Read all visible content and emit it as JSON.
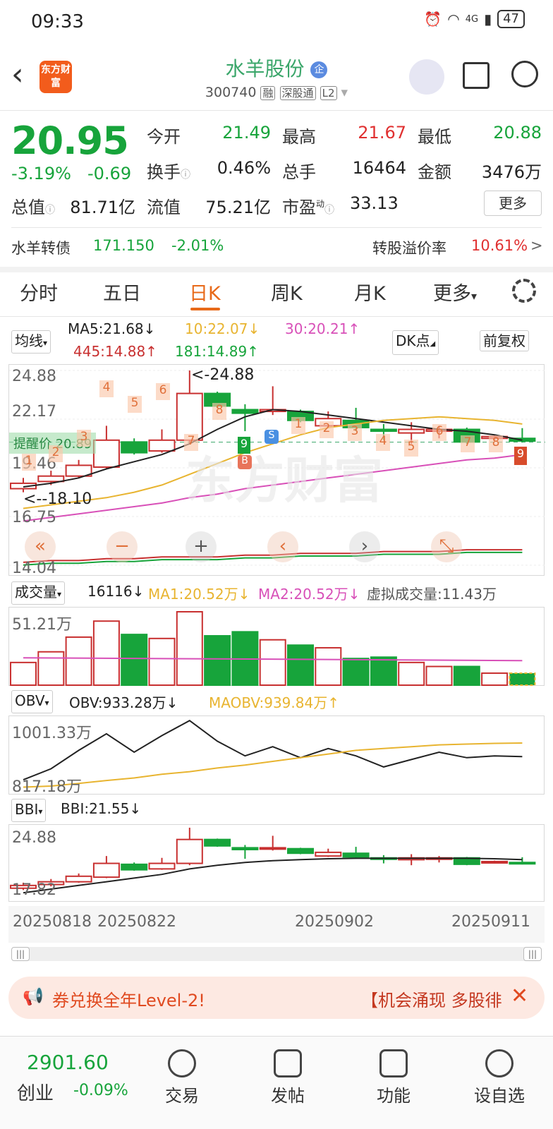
{
  "status": {
    "time": "09:33",
    "network": "4G",
    "battery": "47"
  },
  "header": {
    "back_icon": "chevron-left-icon",
    "app_logo_text": "东方财富",
    "stock_name": "水羊股份",
    "enterprise_badge": "企",
    "code": "300740",
    "tags": [
      "融",
      "深股通",
      "L2"
    ]
  },
  "quote": {
    "price": "20.95",
    "change_pct": "-3.19%",
    "change": "-0.69",
    "open_label": "今开",
    "open": "21.49",
    "high_label": "最高",
    "high": "21.67",
    "low_label": "最低",
    "low": "20.88",
    "turnover_label": "换手",
    "turnover": "0.46%",
    "volume_label": "总手",
    "volume": "16464",
    "amount_label": "金额",
    "amount": "3476万",
    "mcap_label": "总值",
    "mcap": "81.71亿",
    "float_label": "流值",
    "float": "75.21亿",
    "pe_label": "市盈",
    "pe_sup": "动",
    "pe": "33.13",
    "more_button": "更多"
  },
  "conv_bond": {
    "name": "水羊转债",
    "price": "171.150",
    "change": "-2.01%",
    "premium_label": "转股溢价率",
    "premium": "10.61%",
    "arrow": ">"
  },
  "tabs": [
    "分时",
    "五日",
    "日K",
    "周K",
    "月K",
    "更多"
  ],
  "active_tab": "日K",
  "kline": {
    "indicator": "均线",
    "ma5": "MA5:21.68↓",
    "ma10": "10:22.07↓",
    "ma30": "30:20.21↑",
    "ma445": "445:14.88↑",
    "ma181": "181:14.89↑",
    "dk_button": "DK点",
    "adjust_button": "前复权",
    "y_labels": [
      "24.88",
      "22.17",
      "19.46",
      "16.75",
      "14.04"
    ],
    "max_marker": "<-24.88",
    "min_marker": "<--18.10",
    "alert_label": "提醒价",
    "alert_value": "20.89",
    "watermark": "东方财富",
    "marker_b": "B",
    "marker_s": "S",
    "nine_top": "9",
    "nine_last": "9",
    "td_upper": [
      "4",
      "5",
      "6",
      "7",
      "8"
    ],
    "td_lower": [
      "1",
      "2",
      "3",
      "4",
      "5",
      "6",
      "7",
      "8"
    ],
    "td_early": [
      "1",
      "2",
      "3"
    ]
  },
  "volume": {
    "indicator": "成交量",
    "value": "16116↓",
    "ma1": "MA1:20.52万↓",
    "ma2": "MA2:20.52万↓",
    "virtual": "虚拟成交量:11.43万",
    "y_label": "51.21万"
  },
  "obv": {
    "indicator": "OBV",
    "value": "OBV:933.28万↓",
    "maobv": "MAOBV:939.84万↑",
    "y_top": "1001.33万",
    "y_bottom": "817.18万"
  },
  "bbi": {
    "indicator": "BBI",
    "value": "BBI:21.55↓",
    "y_top": "24.88",
    "y_bottom": "17.82"
  },
  "dates": [
    "20250818",
    "20250822",
    "20250902",
    "20250911"
  ],
  "banner": {
    "left": "券兑换全年Level-2!",
    "right": "【机会涌现 多股徘"
  },
  "bottom": {
    "index_value": "2901.60",
    "index_name": "创业",
    "index_change": "-0.09%",
    "items": [
      "交易",
      "发帖",
      "功能",
      "设自选"
    ]
  },
  "colors": {
    "up": "#e03030",
    "down": "#17a43b",
    "accent": "#e86a1a"
  },
  "chart_data": {
    "type": "candlestick",
    "candles": [
      {
        "o": 18.3,
        "c": 18.6,
        "h": 18.9,
        "l": 18.1
      },
      {
        "o": 18.7,
        "c": 19.0,
        "h": 19.3,
        "l": 18.5
      },
      {
        "o": 19.0,
        "c": 19.6,
        "h": 19.9,
        "l": 18.9
      },
      {
        "o": 19.5,
        "c": 21.0,
        "h": 21.8,
        "l": 19.4
      },
      {
        "o": 20.9,
        "c": 20.3,
        "h": 21.1,
        "l": 20.2
      },
      {
        "o": 20.4,
        "c": 21.0,
        "h": 21.6,
        "l": 20.3
      },
      {
        "o": 21.0,
        "c": 23.6,
        "h": 24.88,
        "l": 20.8
      },
      {
        "o": 23.6,
        "c": 22.9,
        "h": 23.7,
        "l": 22.8
      },
      {
        "o": 22.7,
        "c": 22.5,
        "h": 23.0,
        "l": 21.5
      },
      {
        "o": 22.6,
        "c": 22.7,
        "h": 24.0,
        "l": 22.4
      },
      {
        "o": 22.6,
        "c": 22.1,
        "h": 22.7,
        "l": 22.0
      },
      {
        "o": 21.8,
        "c": 22.2,
        "h": 22.6,
        "l": 21.7
      },
      {
        "o": 22.1,
        "c": 21.7,
        "h": 22.8,
        "l": 21.5
      },
      {
        "o": 21.6,
        "c": 21.5,
        "h": 21.9,
        "l": 21.0
      },
      {
        "o": 21.4,
        "c": 21.6,
        "h": 22.0,
        "l": 20.8
      },
      {
        "o": 21.5,
        "c": 21.6,
        "h": 21.8,
        "l": 21.1
      },
      {
        "o": 21.6,
        "c": 20.9,
        "h": 21.7,
        "l": 20.8
      },
      {
        "o": 21.1,
        "c": 21.2,
        "h": 21.3,
        "l": 21.0
      },
      {
        "o": 21.1,
        "c": 20.95,
        "h": 21.67,
        "l": 20.88
      }
    ],
    "volumes": [
      17,
      25,
      36,
      48,
      38,
      35,
      55,
      37,
      40,
      34,
      30,
      28,
      20,
      21,
      17,
      14,
      14,
      9,
      9
    ],
    "vol_ma": 20.52,
    "obv": [
      840,
      870,
      920,
      965,
      915,
      960,
      1001,
      945,
      905,
      930,
      900,
      925,
      905,
      875,
      895,
      915,
      900,
      905,
      903
    ],
    "maobv": [
      820,
      823,
      830,
      838,
      845,
      855,
      862,
      872,
      880,
      890,
      900,
      910,
      920,
      925,
      930,
      935,
      937,
      939,
      940
    ],
    "bbi": [
      17.8,
      18.2,
      18.6,
      19.0,
      19.4,
      19.8,
      20.4,
      20.8,
      21.1,
      21.3,
      21.4,
      21.5,
      21.55,
      21.55,
      21.55,
      21.55,
      21.55,
      21.5,
      21.4
    ],
    "ma5": [
      18.4,
      18.6,
      18.9,
      19.4,
      19.8,
      20.2,
      20.8,
      21.6,
      22.3,
      22.7,
      22.6,
      22.4,
      22.2,
      22.0,
      21.8,
      21.6,
      21.5,
      21.3,
      21.0
    ],
    "ma10": [
      17.2,
      17.4,
      17.6,
      17.8,
      18.1,
      18.5,
      19.1,
      19.7,
      20.3,
      20.8,
      21.3,
      21.7,
      21.9,
      22.1,
      22.2,
      22.3,
      22.2,
      22.1,
      21.9
    ],
    "ma30": [
      16.5,
      16.7,
      16.9,
      17.1,
      17.3,
      17.5,
      17.8,
      18.0,
      18.3,
      18.5,
      18.7,
      18.9,
      19.1,
      19.3,
      19.5,
      19.7,
      19.9,
      20.0,
      20.2
    ],
    "ma_long": [
      14.2,
      14.3,
      14.3,
      14.4,
      14.4,
      14.5,
      14.5,
      14.5,
      14.6,
      14.6,
      14.7,
      14.7,
      14.7,
      14.8,
      14.8,
      14.8,
      14.9,
      14.9,
      14.9
    ],
    "ylim": [
      14.04,
      24.88
    ]
  }
}
